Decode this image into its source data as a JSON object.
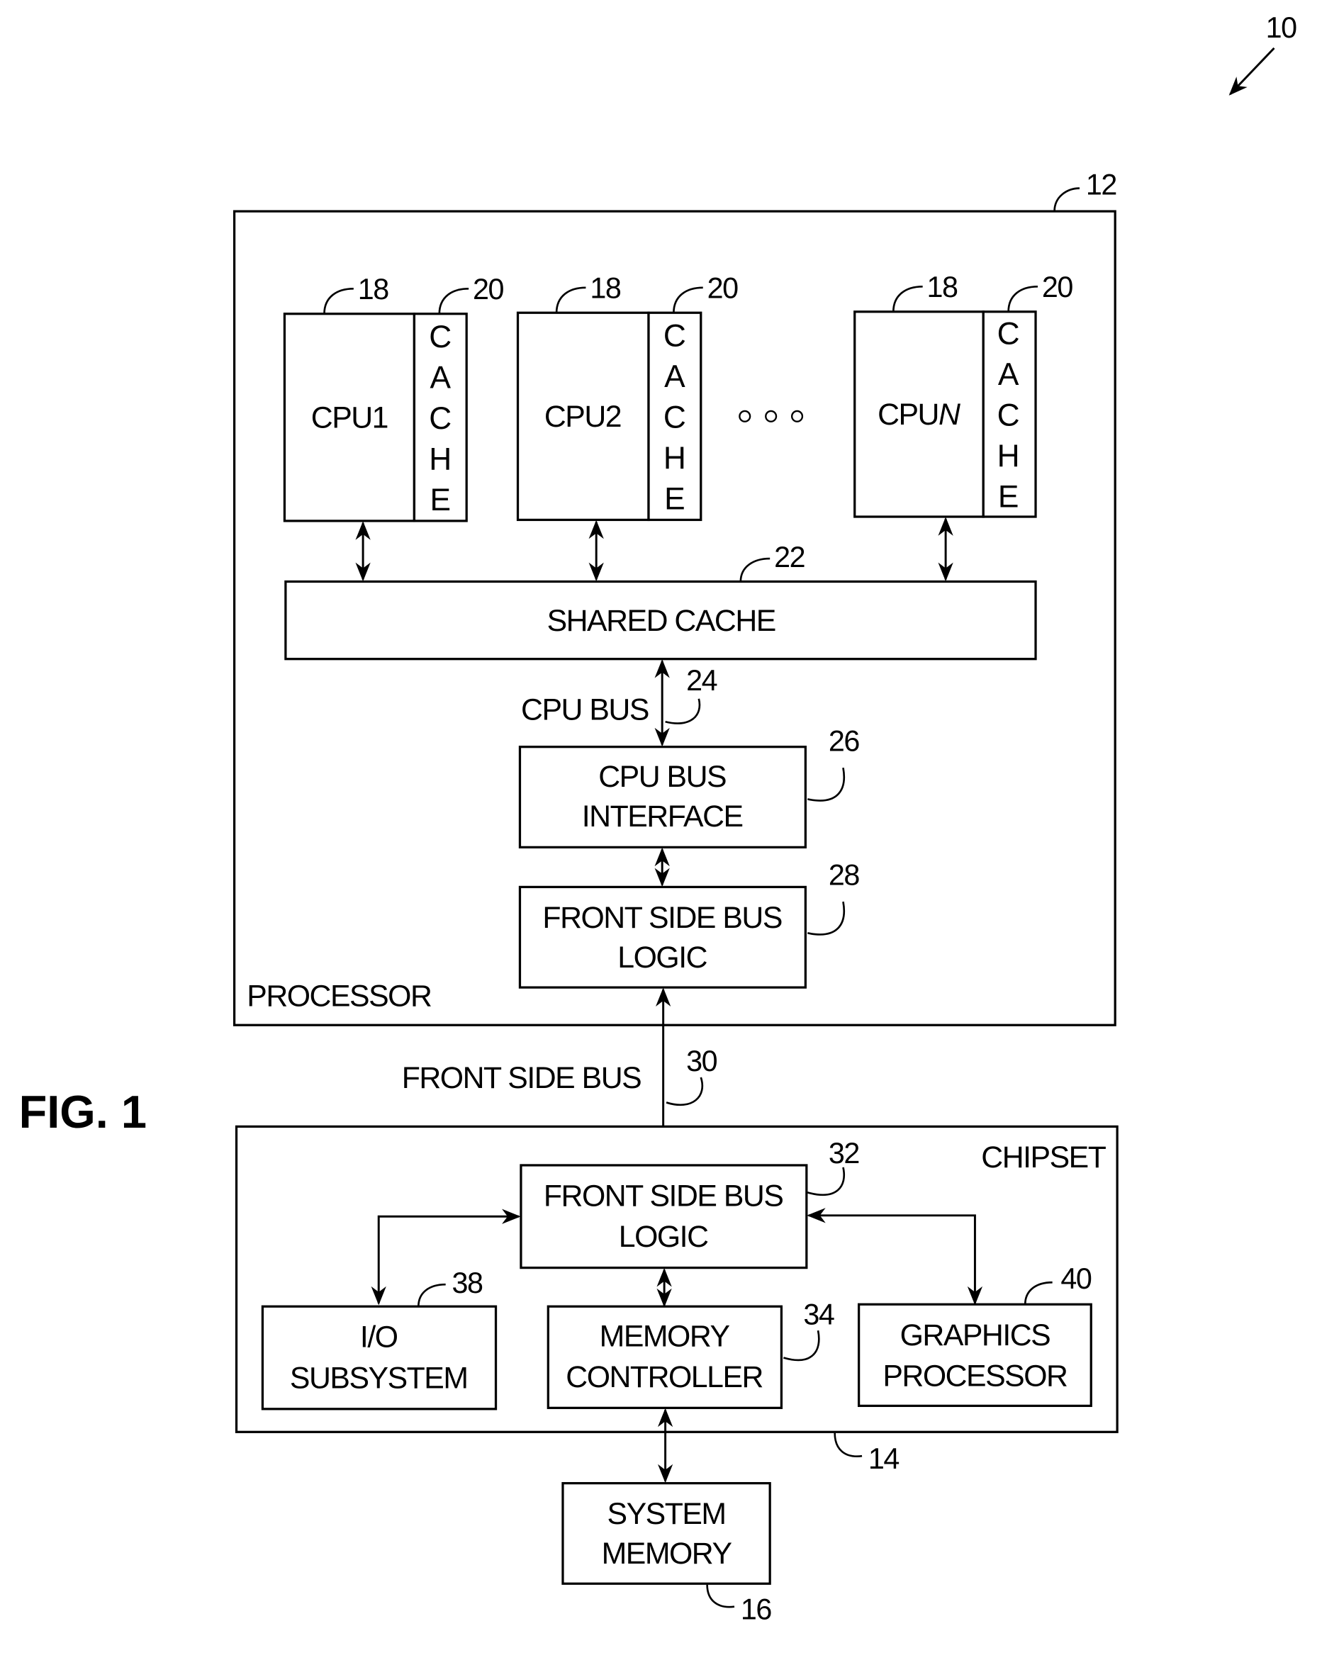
{
  "figure": {
    "label": "FIG. 1",
    "system_ref": "10"
  },
  "processor": {
    "ref": "12",
    "label": "PROCESSOR",
    "cpus": [
      {
        "label": "CPU1",
        "ref": "18",
        "cache_ref": "20"
      },
      {
        "label": "CPU2",
        "ref": "18",
        "cache_ref": "20"
      },
      {
        "label": "CPUN",
        "ref": "18",
        "cache_ref": "20"
      }
    ],
    "cache_letters": [
      "C",
      "A",
      "C",
      "H",
      "E"
    ],
    "ellipsis": "○ ○ ○",
    "shared_cache": {
      "label": "SHARED CACHE",
      "ref": "22"
    },
    "cpu_bus": {
      "label": "CPU BUS",
      "ref": "24"
    },
    "cpu_bus_interface": {
      "line1": "CPU BUS",
      "line2": "INTERFACE",
      "ref": "26"
    },
    "fsb_logic": {
      "line1": "FRONT SIDE BUS",
      "line2": "LOGIC",
      "ref": "28"
    }
  },
  "front_side_bus": {
    "label": "FRONT SIDE BUS",
    "ref": "30"
  },
  "chipset": {
    "ref": "14",
    "label": "CHIPSET",
    "fsb_logic": {
      "line1": "FRONT SIDE BUS",
      "line2": "LOGIC",
      "ref": "32"
    },
    "io_subsystem": {
      "line1": "I/O",
      "line2": "SUBSYSTEM",
      "ref": "38"
    },
    "memory_controller": {
      "line1": "MEMORY",
      "line2": "CONTROLLER",
      "ref": "34"
    },
    "graphics_processor": {
      "line1": "GRAPHICS",
      "line2": "PROCESSOR",
      "ref": "40"
    }
  },
  "system_memory": {
    "line1": "SYSTEM",
    "line2": "MEMORY",
    "ref": "16"
  }
}
